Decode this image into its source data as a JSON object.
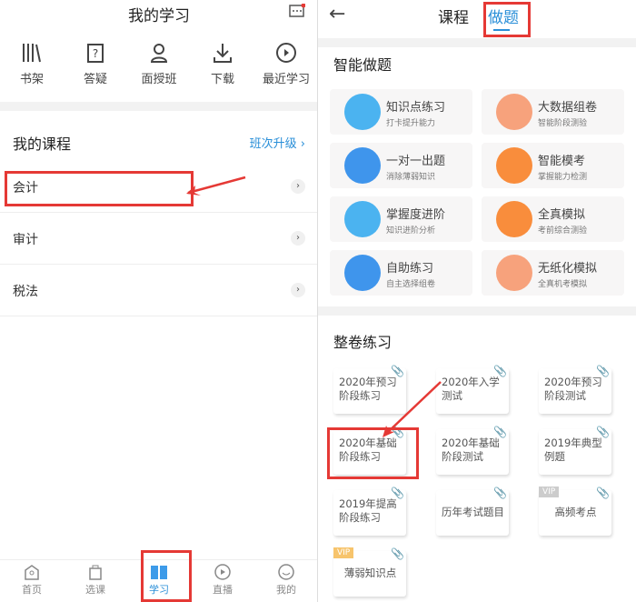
{
  "left": {
    "title": "我的学习",
    "tools": [
      {
        "label": "书架",
        "icon": "bookshelf-icon"
      },
      {
        "label": "答疑",
        "icon": "question-icon"
      },
      {
        "label": "面授班",
        "icon": "teacher-icon"
      },
      {
        "label": "下载",
        "icon": "download-icon"
      },
      {
        "label": "最近学习",
        "icon": "recent-icon"
      }
    ],
    "section_title": "我的课程",
    "upgrade_link": "班次升级",
    "courses": [
      "会计",
      "审计",
      "税法"
    ],
    "nav": [
      {
        "label": "首页"
      },
      {
        "label": "选课"
      },
      {
        "label": "学习"
      },
      {
        "label": "直播"
      },
      {
        "label": "我的"
      }
    ]
  },
  "right": {
    "tabs": [
      "课程",
      "做题"
    ],
    "smart_title": "智能做题",
    "cards": [
      {
        "title": "知识点练习",
        "sub": "打卡提升能力",
        "color": "#4bb3f0"
      },
      {
        "title": "大数据组卷",
        "sub": "智能阶段测验",
        "color": "#f7a27c"
      },
      {
        "title": "一对一出题",
        "sub": "消除薄弱知识",
        "color": "#3f95ec"
      },
      {
        "title": "智能模考",
        "sub": "掌握能力检测",
        "color": "#f98d3c"
      },
      {
        "title": "掌握度进阶",
        "sub": "知识进阶分析",
        "color": "#4bb3f0"
      },
      {
        "title": "全真模拟",
        "sub": "考前综合测验",
        "color": "#f98d3c"
      },
      {
        "title": "自助练习",
        "sub": "自主选择组卷",
        "color": "#3f95ec"
      },
      {
        "title": "无纸化模拟",
        "sub": "全真机考模拟",
        "color": "#f7a27c"
      }
    ],
    "paper_title": "整卷练习",
    "tiles": [
      {
        "label": "2020年预习阶段练习"
      },
      {
        "label": "2020年入学测试"
      },
      {
        "label": "2020年预习阶段测试"
      },
      {
        "label": "2020年基础阶段练习"
      },
      {
        "label": "2020年基础阶段测试"
      },
      {
        "label": "2019年典型例题"
      },
      {
        "label": "2019年提高阶段练习"
      },
      {
        "label": "历年考试题目"
      },
      {
        "label": "高频考点",
        "badge": "VIP"
      },
      {
        "label": "薄弱知识点",
        "badge": "VIP"
      }
    ]
  }
}
